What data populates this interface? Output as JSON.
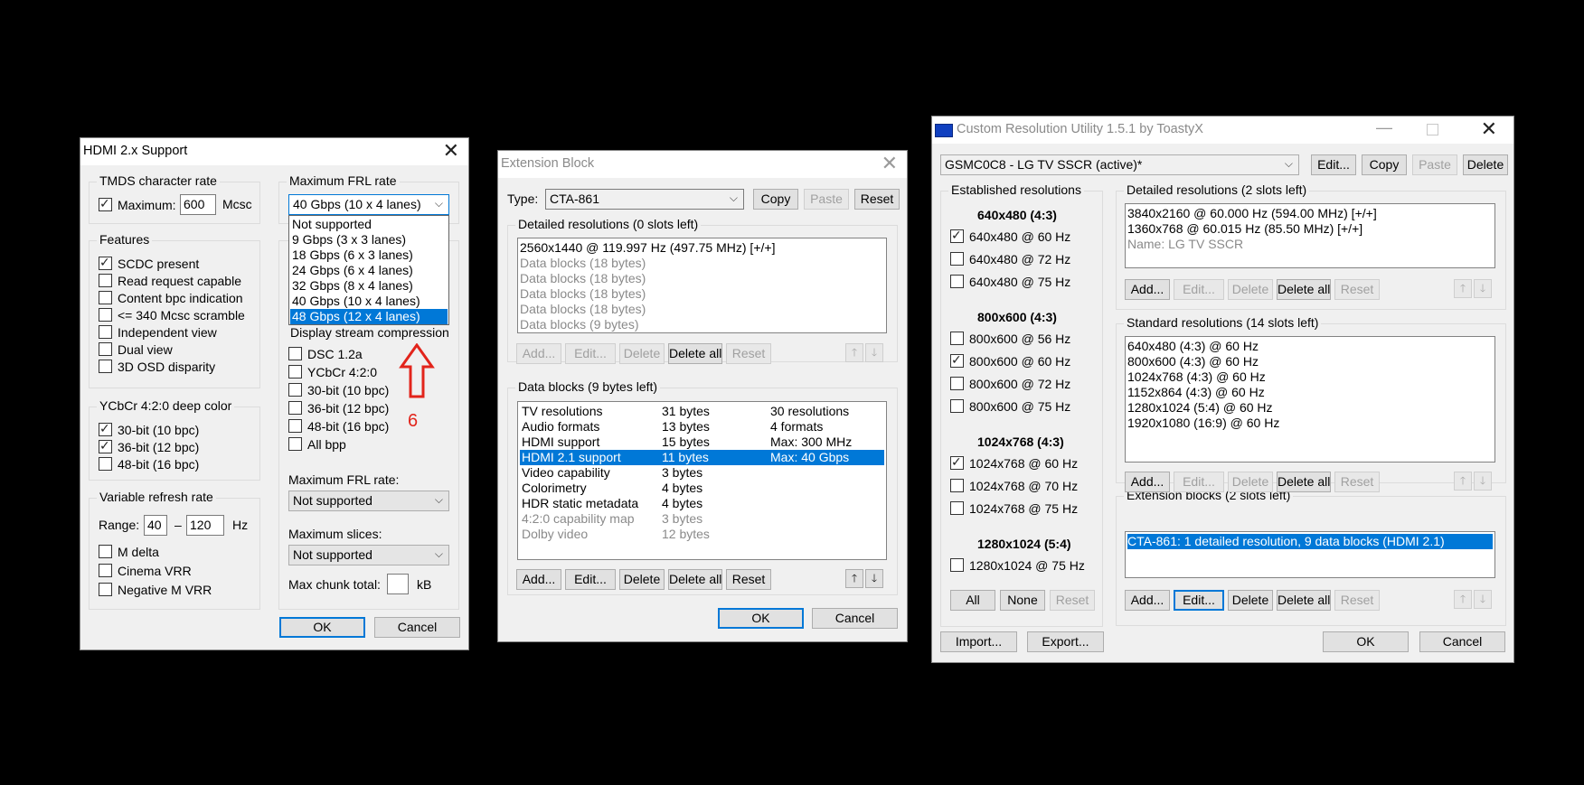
{
  "colors": {
    "accent": "#0078d7",
    "annotation": "#e2241b",
    "background": "#000000"
  },
  "hdmi": {
    "title": "HDMI 2.x Support",
    "tmds": {
      "label": "TMDS character rate",
      "max_label": "Maximum:",
      "max_checked": true,
      "max_value": "600",
      "unit": "Mcsc"
    },
    "features": {
      "label": "Features",
      "items": [
        {
          "label": "SCDC present",
          "checked": true
        },
        {
          "label": "Read request capable",
          "checked": false
        },
        {
          "label": "Content bpc indication",
          "checked": false
        },
        {
          "label": "<= 340 Mcsc scramble",
          "checked": false
        },
        {
          "label": "Independent view",
          "checked": false
        },
        {
          "label": "Dual view",
          "checked": false
        },
        {
          "label": "3D OSD disparity",
          "checked": false
        }
      ]
    },
    "ycbcr": {
      "label": "YCbCr 4:2:0 deep color",
      "items": [
        {
          "label": "30-bit (10 bpc)",
          "checked": true
        },
        {
          "label": "36-bit (12 bpc)",
          "checked": true
        },
        {
          "label": "48-bit (16 bpc)",
          "checked": false
        }
      ]
    },
    "vrr": {
      "label": "Variable refresh rate",
      "range_label": "Range:",
      "min": "40",
      "dash": "–",
      "max": "120",
      "unit": "Hz",
      "items": [
        {
          "label": "M delta",
          "checked": false
        },
        {
          "label": "Cinema VRR",
          "checked": false
        },
        {
          "label": "Negative M VRR",
          "checked": false
        }
      ]
    },
    "frl": {
      "label": "Maximum FRL rate",
      "selected": "40 Gbps (10 x 4 lanes)",
      "options": [
        "Not supported",
        "9 Gbps (3 x 3 lanes)",
        "18 Gbps (6 x 3 lanes)",
        "24 Gbps (6 x 4 lanes)",
        "32 Gbps (8 x 4 lanes)",
        "40 Gbps (10 x 4 lanes)",
        "48 Gbps (12 x 4 lanes)"
      ],
      "highlighted": "48 Gbps (12 x 4 lanes)"
    },
    "dsc": {
      "label": "Display stream compression",
      "items": [
        {
          "label": "DSC 1.2a",
          "checked": false
        },
        {
          "label": "YCbCr 4:2:0",
          "checked": false
        },
        {
          "label": "30-bit (10 bpc)",
          "checked": false
        },
        {
          "label": "36-bit (12 bpc)",
          "checked": false
        },
        {
          "label": "48-bit (16 bpc)",
          "checked": false
        },
        {
          "label": "All bpp",
          "checked": false
        }
      ],
      "frl_label": "Maximum FRL rate:",
      "frl_value": "Not supported",
      "slices_label": "Maximum slices:",
      "slices_value": "Not supported",
      "chunk_label": "Max chunk total:",
      "chunk_value": "",
      "chunk_unit": "kB"
    },
    "annotation_number": "6",
    "ok": "OK",
    "cancel": "Cancel"
  },
  "ext": {
    "title": "Extension Block",
    "type_label": "Type:",
    "type_value": "CTA-861",
    "copy": "Copy",
    "paste": "Paste",
    "reset": "Reset",
    "detailed_label": "Detailed resolutions (0 slots left)",
    "detailed_items": [
      {
        "text": "2560x1440 @ 119.997 Hz (497.75 MHz) [+/+]",
        "dim": false
      },
      {
        "text": "Data blocks (18 bytes)",
        "dim": true
      },
      {
        "text": "Data blocks (18 bytes)",
        "dim": true
      },
      {
        "text": "Data blocks (18 bytes)",
        "dim": true
      },
      {
        "text": "Data blocks (18 bytes)",
        "dim": true
      },
      {
        "text": "Data blocks (9 bytes)",
        "dim": true
      }
    ],
    "detailed_buttons": [
      "Add...",
      "Edit...",
      "Delete",
      "Delete all",
      "Reset"
    ],
    "blocks_label": "Data blocks (9 bytes left)",
    "blocks": [
      {
        "name": "TV resolutions",
        "size": "31 bytes",
        "info": "30 resolutions",
        "dim": false,
        "selected": false
      },
      {
        "name": "Audio formats",
        "size": "13 bytes",
        "info": "4 formats",
        "dim": false,
        "selected": false
      },
      {
        "name": "HDMI support",
        "size": "15 bytes",
        "info": "Max: 300 MHz",
        "dim": false,
        "selected": false
      },
      {
        "name": "HDMI 2.1 support",
        "size": "11 bytes",
        "info": "Max: 40 Gbps",
        "dim": false,
        "selected": true
      },
      {
        "name": "Video capability",
        "size": "3 bytes",
        "info": "",
        "dim": false,
        "selected": false
      },
      {
        "name": "Colorimetry",
        "size": "4 bytes",
        "info": "",
        "dim": false,
        "selected": false
      },
      {
        "name": "HDR static metadata",
        "size": "4 bytes",
        "info": "",
        "dim": false,
        "selected": false
      },
      {
        "name": "4:2:0 capability map",
        "size": "3 bytes",
        "info": "",
        "dim": true,
        "selected": false
      },
      {
        "name": "Dolby video",
        "size": "12 bytes",
        "info": "",
        "dim": true,
        "selected": false
      }
    ],
    "blocks_buttons": [
      "Add...",
      "Edit...",
      "Delete",
      "Delete all",
      "Reset"
    ],
    "ok": "OK",
    "cancel": "Cancel"
  },
  "cru": {
    "title": "Custom Resolution Utility 1.5.1 by ToastyX",
    "monitor": "GSMC0C8 - LG TV SSCR (active)*",
    "top_buttons": [
      "Edit...",
      "Copy",
      "Paste",
      "Delete"
    ],
    "established_label": "Established resolutions",
    "groups": [
      {
        "header": "640x480 (4:3)",
        "items": [
          {
            "label": "640x480 @ 60 Hz",
            "checked": true
          },
          {
            "label": "640x480 @ 72 Hz",
            "checked": false
          },
          {
            "label": "640x480 @ 75 Hz",
            "checked": false
          }
        ]
      },
      {
        "header": "800x600 (4:3)",
        "items": [
          {
            "label": "800x600 @ 56 Hz",
            "checked": false
          },
          {
            "label": "800x600 @ 60 Hz",
            "checked": true
          },
          {
            "label": "800x600 @ 72 Hz",
            "checked": false
          },
          {
            "label": "800x600 @ 75 Hz",
            "checked": false
          }
        ]
      },
      {
        "header": "1024x768 (4:3)",
        "items": [
          {
            "label": "1024x768 @ 60 Hz",
            "checked": true
          },
          {
            "label": "1024x768 @ 70 Hz",
            "checked": false
          },
          {
            "label": "1024x768 @ 75 Hz",
            "checked": false
          }
        ]
      },
      {
        "header": "1280x1024 (5:4)",
        "items": [
          {
            "label": "1280x1024 @ 75 Hz",
            "checked": false
          }
        ]
      }
    ],
    "est_buttons": [
      "All",
      "None",
      "Reset"
    ],
    "detailed_label": "Detailed resolutions (2 slots left)",
    "detailed_items": [
      {
        "text": "3840x2160 @ 60.000 Hz (594.00 MHz) [+/+]",
        "dim": false
      },
      {
        "text": "1360x768 @ 60.015 Hz (85.50 MHz) [+/+]",
        "dim": false
      },
      {
        "text": "Name: LG TV SSCR",
        "dim": true
      }
    ],
    "standard_label": "Standard resolutions (14 slots left)",
    "standard_items": [
      "640x480 (4:3) @ 60 Hz",
      "800x600 (4:3) @ 60 Hz",
      "1024x768 (4:3) @ 60 Hz",
      "1152x864 (4:3) @ 60 Hz",
      "1280x1024 (5:4) @ 60 Hz",
      "1920x1080 (16:9) @ 60 Hz"
    ],
    "ext_label": "Extension blocks (2 slots left)",
    "ext_items": [
      "CTA-861: 1 detailed resolution, 9 data blocks (HDMI 2.1)"
    ],
    "list_buttons": [
      "Add...",
      "Edit...",
      "Delete",
      "Delete all",
      "Reset"
    ],
    "import": "Import...",
    "export": "Export...",
    "ok": "OK",
    "cancel": "Cancel"
  }
}
